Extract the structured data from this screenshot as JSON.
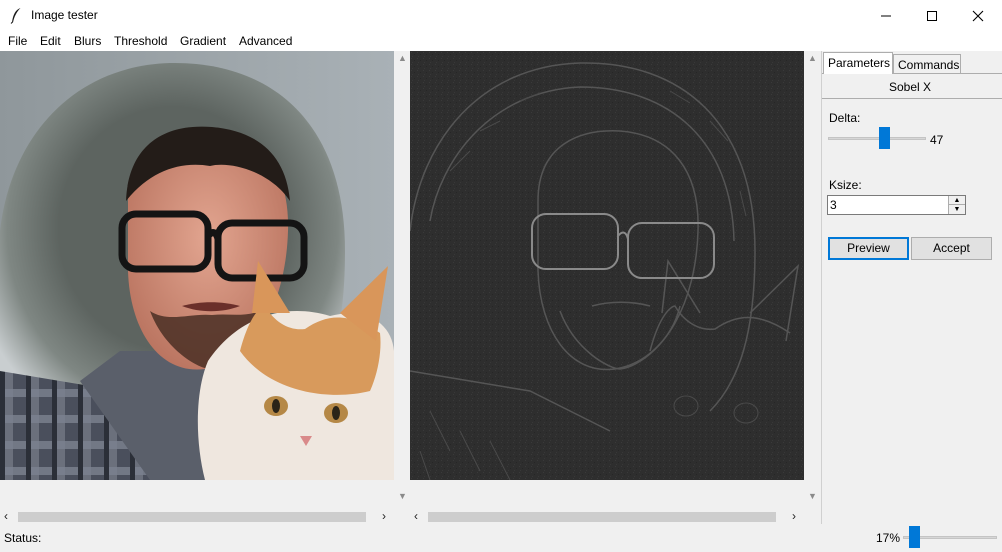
{
  "window": {
    "title": "Image tester",
    "icon": "feather-icon",
    "controls": [
      "minimize-icon",
      "maximize-icon",
      "close-icon"
    ]
  },
  "menu": [
    "File",
    "Edit",
    "Blurs",
    "Threshold",
    "Gradient",
    "Advanced"
  ],
  "panes": {
    "original": {
      "image": "photo of a man in a fur-lined hood holding an orange and white cat"
    },
    "result": {
      "image": "Sobel X gradient of the same photo, grey embossed edges"
    }
  },
  "sidebar": {
    "tabs": [
      "Parameters",
      "Commands"
    ],
    "active_tab": "Parameters",
    "filter_name": "Sobel X",
    "delta": {
      "label": "Delta:",
      "value": 47,
      "display": "47"
    },
    "ksize": {
      "label": "Ksize:",
      "value": "3"
    },
    "buttons": {
      "preview": "Preview",
      "accept": "Accept"
    }
  },
  "status": {
    "label": "Status:",
    "zoom_text": "17%",
    "zoom": 17
  },
  "colors": {
    "accent": "#0078d7",
    "window_bg": "#f0f0f0",
    "result_bg": "#2e2e2e"
  }
}
